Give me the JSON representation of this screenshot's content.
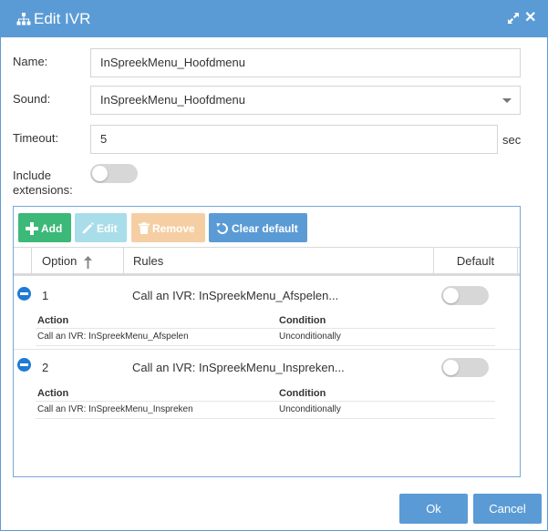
{
  "dialog": {
    "title": "Edit IVR",
    "icons": {
      "title": "sitemap-icon",
      "maximize": "maximize-icon",
      "close": "close-icon"
    }
  },
  "form": {
    "name_label": "Name:",
    "name_value": "InSpreekMenu_Hoofdmenu",
    "sound_label": "Sound:",
    "sound_value": "InSpreekMenu_Hoofdmenu",
    "timeout_label": "Timeout:",
    "timeout_value": "5",
    "timeout_unit": "sec",
    "include_line1": "Include",
    "include_line2": "extensions:",
    "include_enabled": false
  },
  "toolbar": {
    "add": "Add",
    "edit": "Edit",
    "remove": "Remove",
    "clear_default": "Clear default"
  },
  "grid": {
    "columns": {
      "option": "Option",
      "rules": "Rules",
      "default": "Default"
    },
    "rows": [
      {
        "option": "1",
        "rules": "Call an IVR: InSpreekMenu_Afspelen...",
        "default": false,
        "action_header": "Action",
        "condition_header": "Condition",
        "action": "Call an IVR: InSpreekMenu_Afspelen",
        "condition": "Unconditionally"
      },
      {
        "option": "2",
        "rules": "Call an IVR: InSpreekMenu_Inspreken...",
        "default": false,
        "action_header": "Action",
        "condition_header": "Condition",
        "action": "Call an IVR: InSpreekMenu_Inspreken",
        "condition": "Unconditionally"
      }
    ]
  },
  "footer": {
    "ok": "Ok",
    "cancel": "Cancel"
  },
  "colors": {
    "titlebar": "#5b9bd5",
    "add": "#3cb878",
    "edit_disabled": "#a8dde9",
    "remove_disabled": "#f5cfa3",
    "clear_default": "#5b9bd5",
    "remove_row": "#1e7ad6"
  }
}
